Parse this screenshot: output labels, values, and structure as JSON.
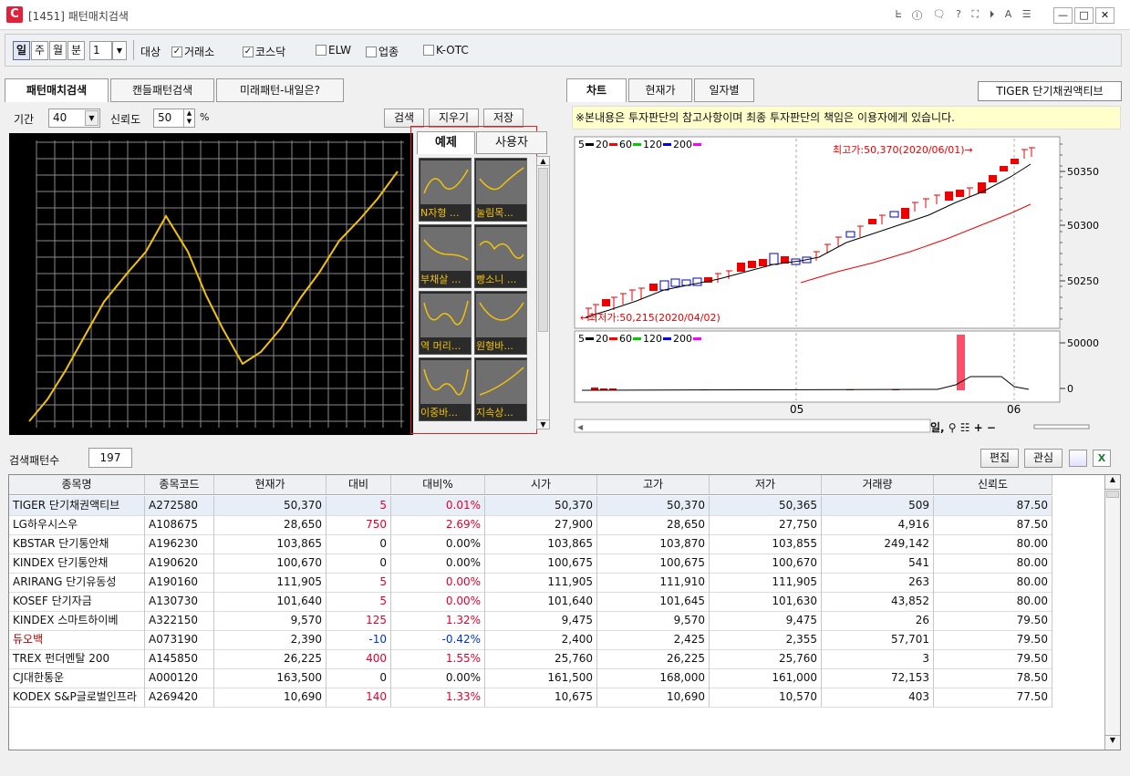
{
  "window": {
    "title": "[1451] 패턴매치검색",
    "logo": "C",
    "tools": "ᖶ ⓘ 🗨 ? ⛶ ⏵ A ☰",
    "btn_min": "—",
    "btn_max": "□",
    "btn_close": "✕"
  },
  "toolbar": {
    "periods": [
      "일",
      "주",
      "월",
      "분"
    ],
    "interval": "1",
    "target_label": "대상",
    "targets": [
      {
        "label": "거래소",
        "checked": true
      },
      {
        "label": "코스닥",
        "checked": true
      },
      {
        "label": "ELW",
        "checked": false
      },
      {
        "label": "업종",
        "checked": false
      },
      {
        "label": "K-OTC",
        "checked": false
      }
    ]
  },
  "left": {
    "tabs": [
      "패턴매치검색",
      "캔들패턴검색",
      "미래패턴-내일은?"
    ],
    "period_label": "기간",
    "period_value": "40",
    "reliability_label": "신뢰도",
    "reliability_value": "50",
    "percent": "%",
    "search": "검색",
    "clear": "지우기",
    "save": "저장",
    "pattern_tabs": [
      "예제",
      "사용자"
    ],
    "patterns": [
      "N자형 ...",
      "눌림목...",
      "부채살 ...",
      "빵소니 ...",
      "역 머리...",
      "원형바...",
      "이중바...",
      "지속상..."
    ]
  },
  "right": {
    "tabs": [
      "차트",
      "현재가",
      "일자별"
    ],
    "stock_name": "TIGER 단기채권액티브",
    "notice": "※본내용은 투자판단의 참고사항이며 최종 투자판단의 책임은 이용자에게 있습니다.",
    "ma_legend": [
      "5",
      "20",
      "60",
      "120",
      "200"
    ],
    "high_label": "최고가:50,370(2020/06/01)→",
    "low_label": "←최저가:50,215(2020/04/02)",
    "y_ticks": [
      "50350",
      "50300",
      "50250"
    ],
    "vol_ticks": [
      "50000",
      "0"
    ],
    "x_ticks": [
      "05",
      "06"
    ],
    "bottom_ctrl": "일, ⚲ ☷ + −"
  },
  "colors": {
    "ma5": "#000000",
    "ma20": "#ff0000",
    "ma60": "#00cc00",
    "ma120": "#0000ff",
    "ma200": "#ff00ff"
  },
  "results": {
    "count_label": "검색패턴수",
    "count": "197",
    "edit": "편집",
    "interest": "관심",
    "columns": [
      "종목명",
      "종목코드",
      "현재가",
      "대비",
      "대비%",
      "시가",
      "고가",
      "저가",
      "거래량",
      "신뢰도"
    ],
    "rows": [
      [
        "TIGER 단기채권액티브",
        "A272580",
        "50,370",
        "5",
        "0.01%",
        "50,370",
        "50,370",
        "50,365",
        "509",
        "87.50"
      ],
      [
        "LG하우시스우",
        "A108675",
        "28,650",
        "750",
        "2.69%",
        "27,900",
        "28,650",
        "27,750",
        "4,916",
        "87.50"
      ],
      [
        "KBSTAR 단기통안채",
        "A196230",
        "103,865",
        "0",
        "0.00%",
        "103,865",
        "103,870",
        "103,855",
        "249,142",
        "80.00"
      ],
      [
        "KINDEX 단기통안채",
        "A190620",
        "100,670",
        "0",
        "0.00%",
        "100,675",
        "100,675",
        "100,670",
        "541",
        "80.00"
      ],
      [
        "ARIRANG 단기유동성",
        "A190160",
        "111,905",
        "5",
        "0.00%",
        "111,905",
        "111,910",
        "111,905",
        "263",
        "80.00"
      ],
      [
        "KOSEF 단기자금",
        "A130730",
        "101,640",
        "5",
        "0.00%",
        "101,640",
        "101,645",
        "101,630",
        "43,852",
        "80.00"
      ],
      [
        "KINDEX 스마트하이베",
        "A322150",
        "9,570",
        "125",
        "1.32%",
        "9,475",
        "9,570",
        "9,475",
        "26",
        "79.50"
      ],
      [
        "듀오백",
        "A073190",
        "2,390",
        "-10",
        "-0.42%",
        "2,400",
        "2,425",
        "2,355",
        "57,701",
        "79.50"
      ],
      [
        "TREX 펀더멘탈 200",
        "A145850",
        "26,225",
        "400",
        "1.55%",
        "25,760",
        "26,225",
        "25,760",
        "3",
        "79.50"
      ],
      [
        "CJ대한통운",
        "A000120",
        "163,500",
        "0",
        "0.00%",
        "161,500",
        "168,000",
        "161,000",
        "72,153",
        "78.50"
      ],
      [
        "KODEX S&P글로벌인프라",
        "A269420",
        "10,690",
        "140",
        "1.33%",
        "10,675",
        "10,690",
        "10,570",
        "403",
        "77.50"
      ]
    ],
    "row_colors": [
      "red",
      "red",
      "",
      "",
      "red",
      "red",
      "red",
      "blue",
      "red",
      "",
      "red"
    ]
  }
}
